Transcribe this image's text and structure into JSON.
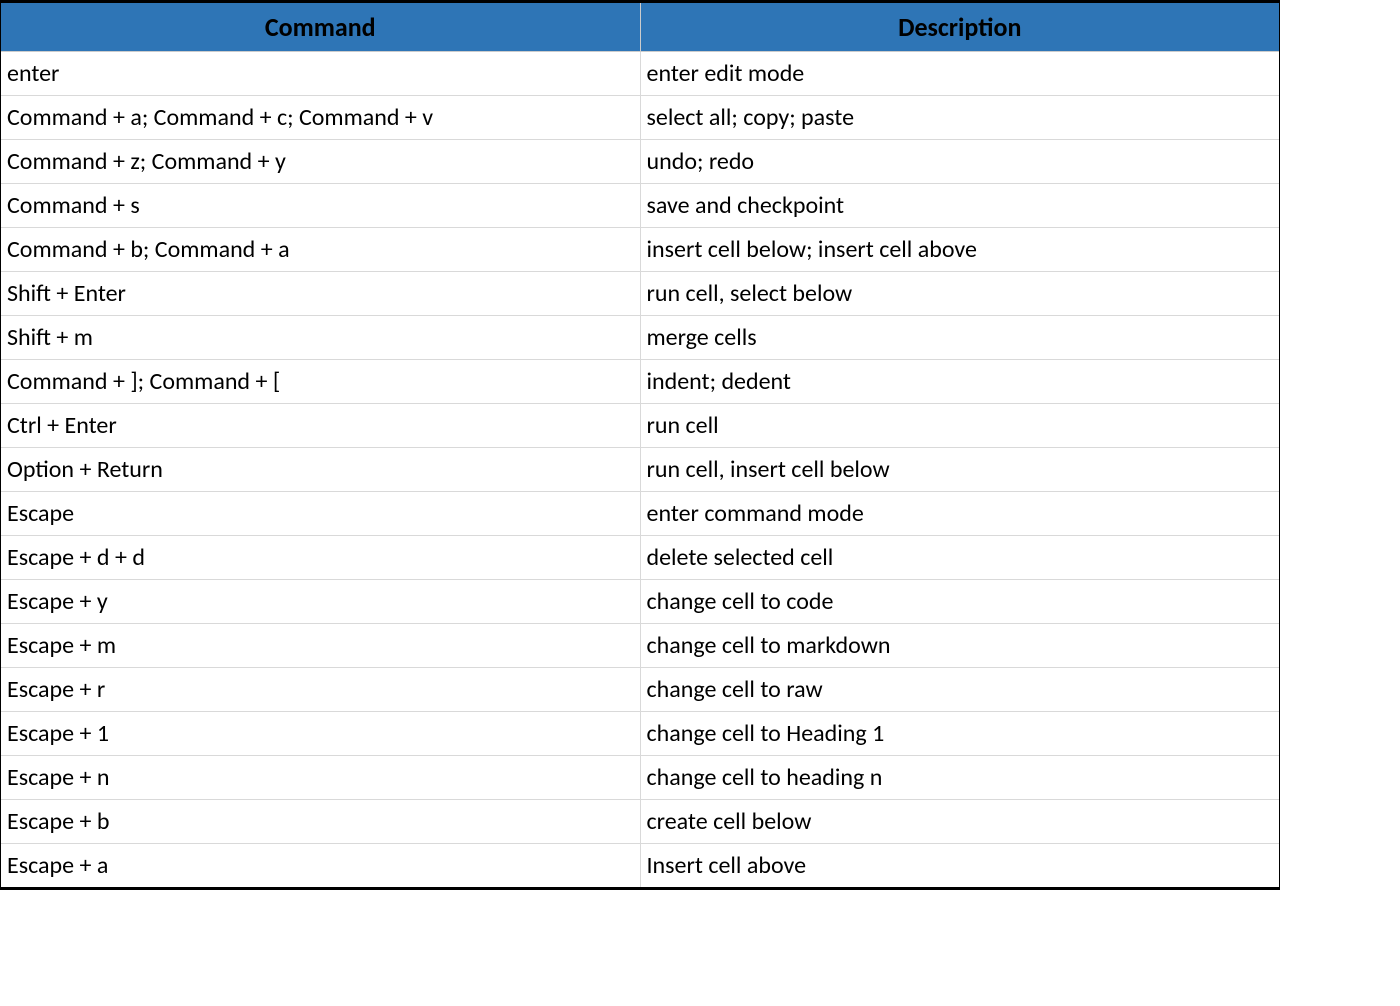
{
  "table": {
    "headers": {
      "command": "Command",
      "description": "Description"
    },
    "rows": [
      {
        "command": "enter",
        "description": "enter edit mode"
      },
      {
        "command": "Command + a; Command + c; Command + v",
        "description": "select all; copy; paste"
      },
      {
        "command": "Command + z; Command + y",
        "description": "undo; redo"
      },
      {
        "command": "Command + s",
        "description": "save and checkpoint"
      },
      {
        "command": "Command + b; Command + a",
        "description": "insert cell below; insert cell above"
      },
      {
        "command": "Shift + Enter",
        "description": "run cell, select below"
      },
      {
        "command": "Shift + m",
        "description": "merge cells"
      },
      {
        "command": "Command + ]; Command + [",
        "description": "indent; dedent"
      },
      {
        "command": "Ctrl + Enter",
        "description": "run cell"
      },
      {
        "command": "Option + Return",
        "description": "run cell, insert cell below"
      },
      {
        "command": "Escape",
        "description": "enter command mode"
      },
      {
        "command": "Escape + d + d",
        "description": "delete selected cell"
      },
      {
        "command": "Escape + y",
        "description": "change cell to code"
      },
      {
        "command": "Escape + m",
        "description": "change cell to markdown"
      },
      {
        "command": "Escape + r",
        "description": "change cell to raw"
      },
      {
        "command": "Escape + 1",
        "description": "change cell to Heading 1"
      },
      {
        "command": "Escape + n",
        "description": "change cell to heading n"
      },
      {
        "command": "Escape + b",
        "description": "create cell below"
      },
      {
        "command": "Escape + a",
        "description": "Insert cell above"
      }
    ]
  }
}
